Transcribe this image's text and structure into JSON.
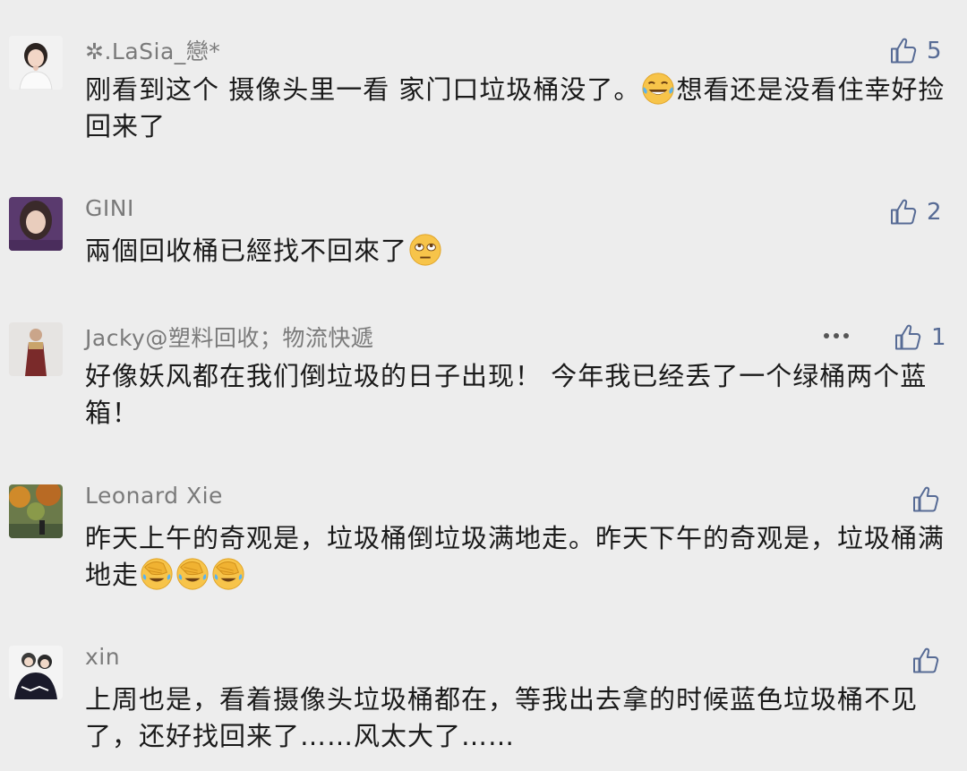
{
  "comments": [
    {
      "author": "✲.LaSia_戀*",
      "text": [
        "刚看到这个 摄像头里一看 家门口垃圾桶没了。",
        "想看还是没看住幸好捡回来了"
      ],
      "likes": "5"
    },
    {
      "author": "GINI",
      "text": [
        "兩個回收桶已經找不回來了"
      ],
      "likes": "2"
    },
    {
      "author": "Jacky@塑料回收；物流快遞",
      "text": [
        "好像妖风都在我们倒垃圾的日子出现！ 今年我已经丢了一个绿桶两个蓝箱！"
      ],
      "likes": "1"
    },
    {
      "author": "Leonard Xie",
      "text": [
        "昨天上午的奇观是，垃圾桶倒垃圾满地走。昨天下午的奇观是，垃圾桶满地走"
      ],
      "likes": ""
    },
    {
      "author": "xin",
      "text": [
        "上周也是，看着摄像头垃圾桶都在，等我出去拿的时候蓝色垃圾桶不见了，还好找回来了……风太大了……"
      ],
      "likes": ""
    }
  ],
  "icons": {
    "like": "thumbs-up-outline-icon",
    "more": "more-dots-icon",
    "emoji_tears_joy": "tears-of-joy-emoji",
    "emoji_eye_roll": "eye-roll-emoji",
    "emoji_facepalm": "facepalm-emoji"
  },
  "colors": {
    "background": "#ededed",
    "like_blue": "#576b95",
    "author_gray": "#7a7a7a",
    "text": "#1a1a1a"
  }
}
